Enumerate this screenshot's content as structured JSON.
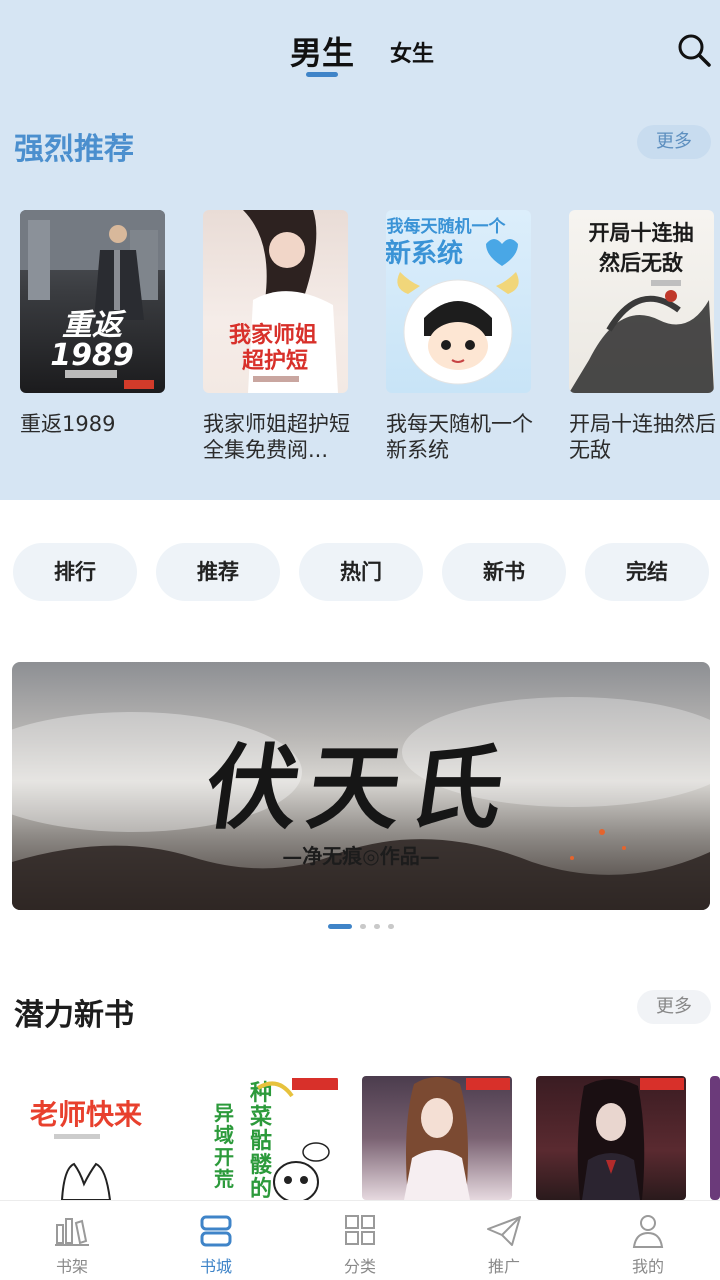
{
  "header": {
    "tabs": [
      {
        "label": "男生",
        "active": true
      },
      {
        "label": "女生",
        "active": false
      }
    ],
    "search_icon": "search-icon"
  },
  "recommend": {
    "title": "强烈推荐",
    "more_label": "更多",
    "books": [
      {
        "title": "重返1989",
        "cover_text": "重返1989"
      },
      {
        "title": "我家师姐超护短全集免费阅...",
        "cover_text": "我家师姐超护短"
      },
      {
        "title": "我每天随机一个新系统",
        "cover_text": "我每天随机一个新系统"
      },
      {
        "title": "开局十连抽然后无敌",
        "cover_text": "开局十连抽然后无敌"
      }
    ]
  },
  "categories": [
    "排行",
    "推荐",
    "热门",
    "新书",
    "完结"
  ],
  "banner": {
    "title": "伏天氏",
    "subtitle": "—净无痕◎作品—",
    "dots_count": 4,
    "active_dot": 0
  },
  "potential": {
    "title": "潜力新书",
    "more_label": "更多",
    "books": [
      {
        "cover_text": "老师快来"
      },
      {
        "cover_text": "种菜骷髅的异域开荒"
      },
      {
        "cover_text": ""
      },
      {
        "cover_text": ""
      }
    ]
  },
  "bottom_nav": [
    {
      "label": "书架",
      "icon": "bookshelf-icon",
      "active": false
    },
    {
      "label": "书城",
      "icon": "bookstore-icon",
      "active": true
    },
    {
      "label": "分类",
      "icon": "category-grid-icon",
      "active": false
    },
    {
      "label": "推广",
      "icon": "paper-plane-icon",
      "active": false
    },
    {
      "label": "我的",
      "icon": "user-icon",
      "active": false
    }
  ],
  "colors": {
    "accent": "#3f84c8",
    "header_bg": "#d6e5f3",
    "section_title_blue": "#4b8fce"
  }
}
